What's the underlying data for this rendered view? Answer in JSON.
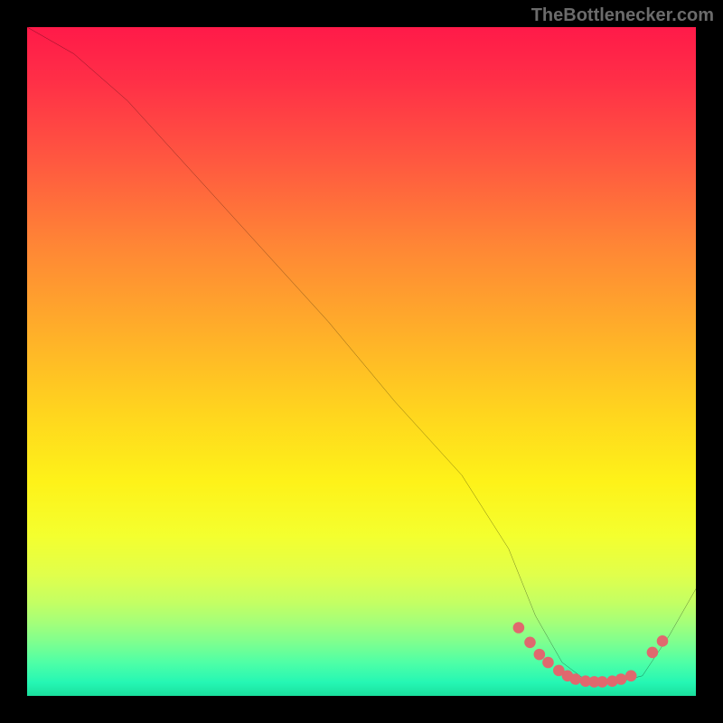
{
  "watermark": "TheBottlenecker.com",
  "chart_data": {
    "type": "line",
    "title": "",
    "xlabel": "",
    "ylabel": "",
    "xlim": [
      0,
      100
    ],
    "ylim": [
      0,
      100
    ],
    "note": "No axis ticks or numeric labels visible; values are relative 0-100 estimates read from the geometry.",
    "series": [
      {
        "name": "curve",
        "x": [
          0,
          7,
          15,
          25,
          35,
          45,
          55,
          65,
          72,
          76,
          80,
          84,
          88,
          92,
          96,
          100
        ],
        "y": [
          100,
          96,
          89,
          78,
          67,
          56,
          44,
          33,
          22,
          12,
          5,
          2,
          2,
          3,
          9,
          16
        ],
        "stroke": "#000000"
      }
    ],
    "markers": {
      "name": "dots",
      "color": "#e0686e",
      "x": [
        73.5,
        75.2,
        76.6,
        77.9,
        79.5,
        80.8,
        82.0,
        83.5,
        84.8,
        86.0,
        87.5,
        88.8,
        90.3,
        93.5,
        95.0
      ],
      "y": [
        10.2,
        8.0,
        6.2,
        5.0,
        3.8,
        3.0,
        2.5,
        2.2,
        2.1,
        2.1,
        2.2,
        2.5,
        3.0,
        6.5,
        8.2
      ]
    }
  }
}
